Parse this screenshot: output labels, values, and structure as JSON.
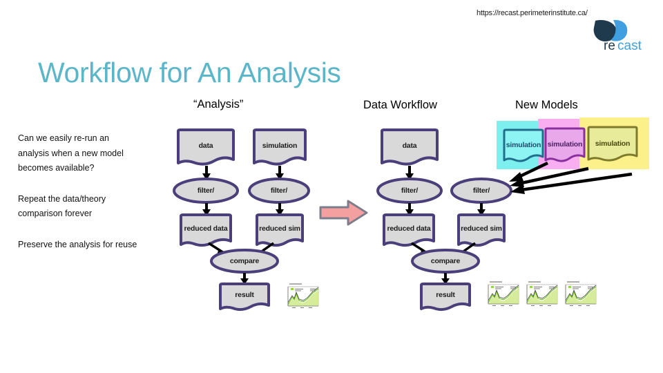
{
  "header": {
    "url": "https://recast.perimeterinstitute.ca/",
    "logo_name": "recast-logo",
    "logo_wordmark_dark": "re",
    "logo_wordmark_light": "cast",
    "logo_color_dark": "#1f3a4d",
    "logo_color_light": "#3f9fe0"
  },
  "title": "Workflow for An Analysis",
  "columns": {
    "analysis": "“Analysis”",
    "data_workflow": "Data Workflow",
    "new_models": "New Models"
  },
  "bullets": [
    "Can we easily re-run an analysis when a new model becomes available?",
    "Repeat the data/theory comparison forever",
    "Preserve the analysis for reuse"
  ],
  "diagram_colors": {
    "node_stroke": "#4a3f7a",
    "node_fill": "#d9d9d9",
    "arrow_black": "#000000",
    "big_arrow_fill": "#f4a0a0",
    "big_arrow_stroke": "#7d7d8c"
  },
  "workflow_analysis": {
    "nodes": [
      {
        "id": "data",
        "label": "data",
        "shape": "document"
      },
      {
        "id": "simulation",
        "label": "simulation",
        "shape": "document"
      },
      {
        "id": "filter_left",
        "label": "filter/",
        "shape": "ellipse"
      },
      {
        "id": "filter_right",
        "label": "filter/",
        "shape": "ellipse"
      },
      {
        "id": "reduced_data",
        "label": "reduced data",
        "shape": "document"
      },
      {
        "id": "reduced_sim",
        "label": "reduced sim",
        "shape": "document"
      },
      {
        "id": "compare",
        "label": "compare",
        "shape": "ellipse"
      },
      {
        "id": "result",
        "label": "result",
        "shape": "document"
      }
    ]
  },
  "workflow_data": {
    "nodes": [
      {
        "id": "data",
        "label": "data",
        "shape": "document"
      },
      {
        "id": "filter_left",
        "label": "filter/",
        "shape": "ellipse"
      },
      {
        "id": "filter_right",
        "label": "filter/",
        "shape": "ellipse"
      },
      {
        "id": "reduced_data",
        "label": "reduced data",
        "shape": "document"
      },
      {
        "id": "reduced_sim",
        "label": "reduced sim",
        "shape": "document"
      },
      {
        "id": "compare",
        "label": "compare",
        "shape": "ellipse"
      },
      {
        "id": "result",
        "label": "result",
        "shape": "document"
      }
    ]
  },
  "new_models": [
    {
      "label": "simulation",
      "block_color": "#7defef",
      "card_fill": "#8df3f3",
      "card_stroke": "#1f6e8c",
      "text_color": "#1f4e6e"
    },
    {
      "label": "simulation",
      "block_color": "#f9aef2",
      "card_fill": "#e9a8e9",
      "card_stroke": "#8a2f9e",
      "text_color": "#4b1f63"
    },
    {
      "label": "simulation",
      "block_color": "#fbf08a",
      "card_fill": "#e8eb9a",
      "card_stroke": "#7d7a2c",
      "text_color": "#4a4a10"
    }
  ],
  "result_plots": {
    "count_analysis": 1,
    "count_workflow": 3,
    "accent": "#8ddb2b",
    "name": "result-plot-thumbnail"
  }
}
